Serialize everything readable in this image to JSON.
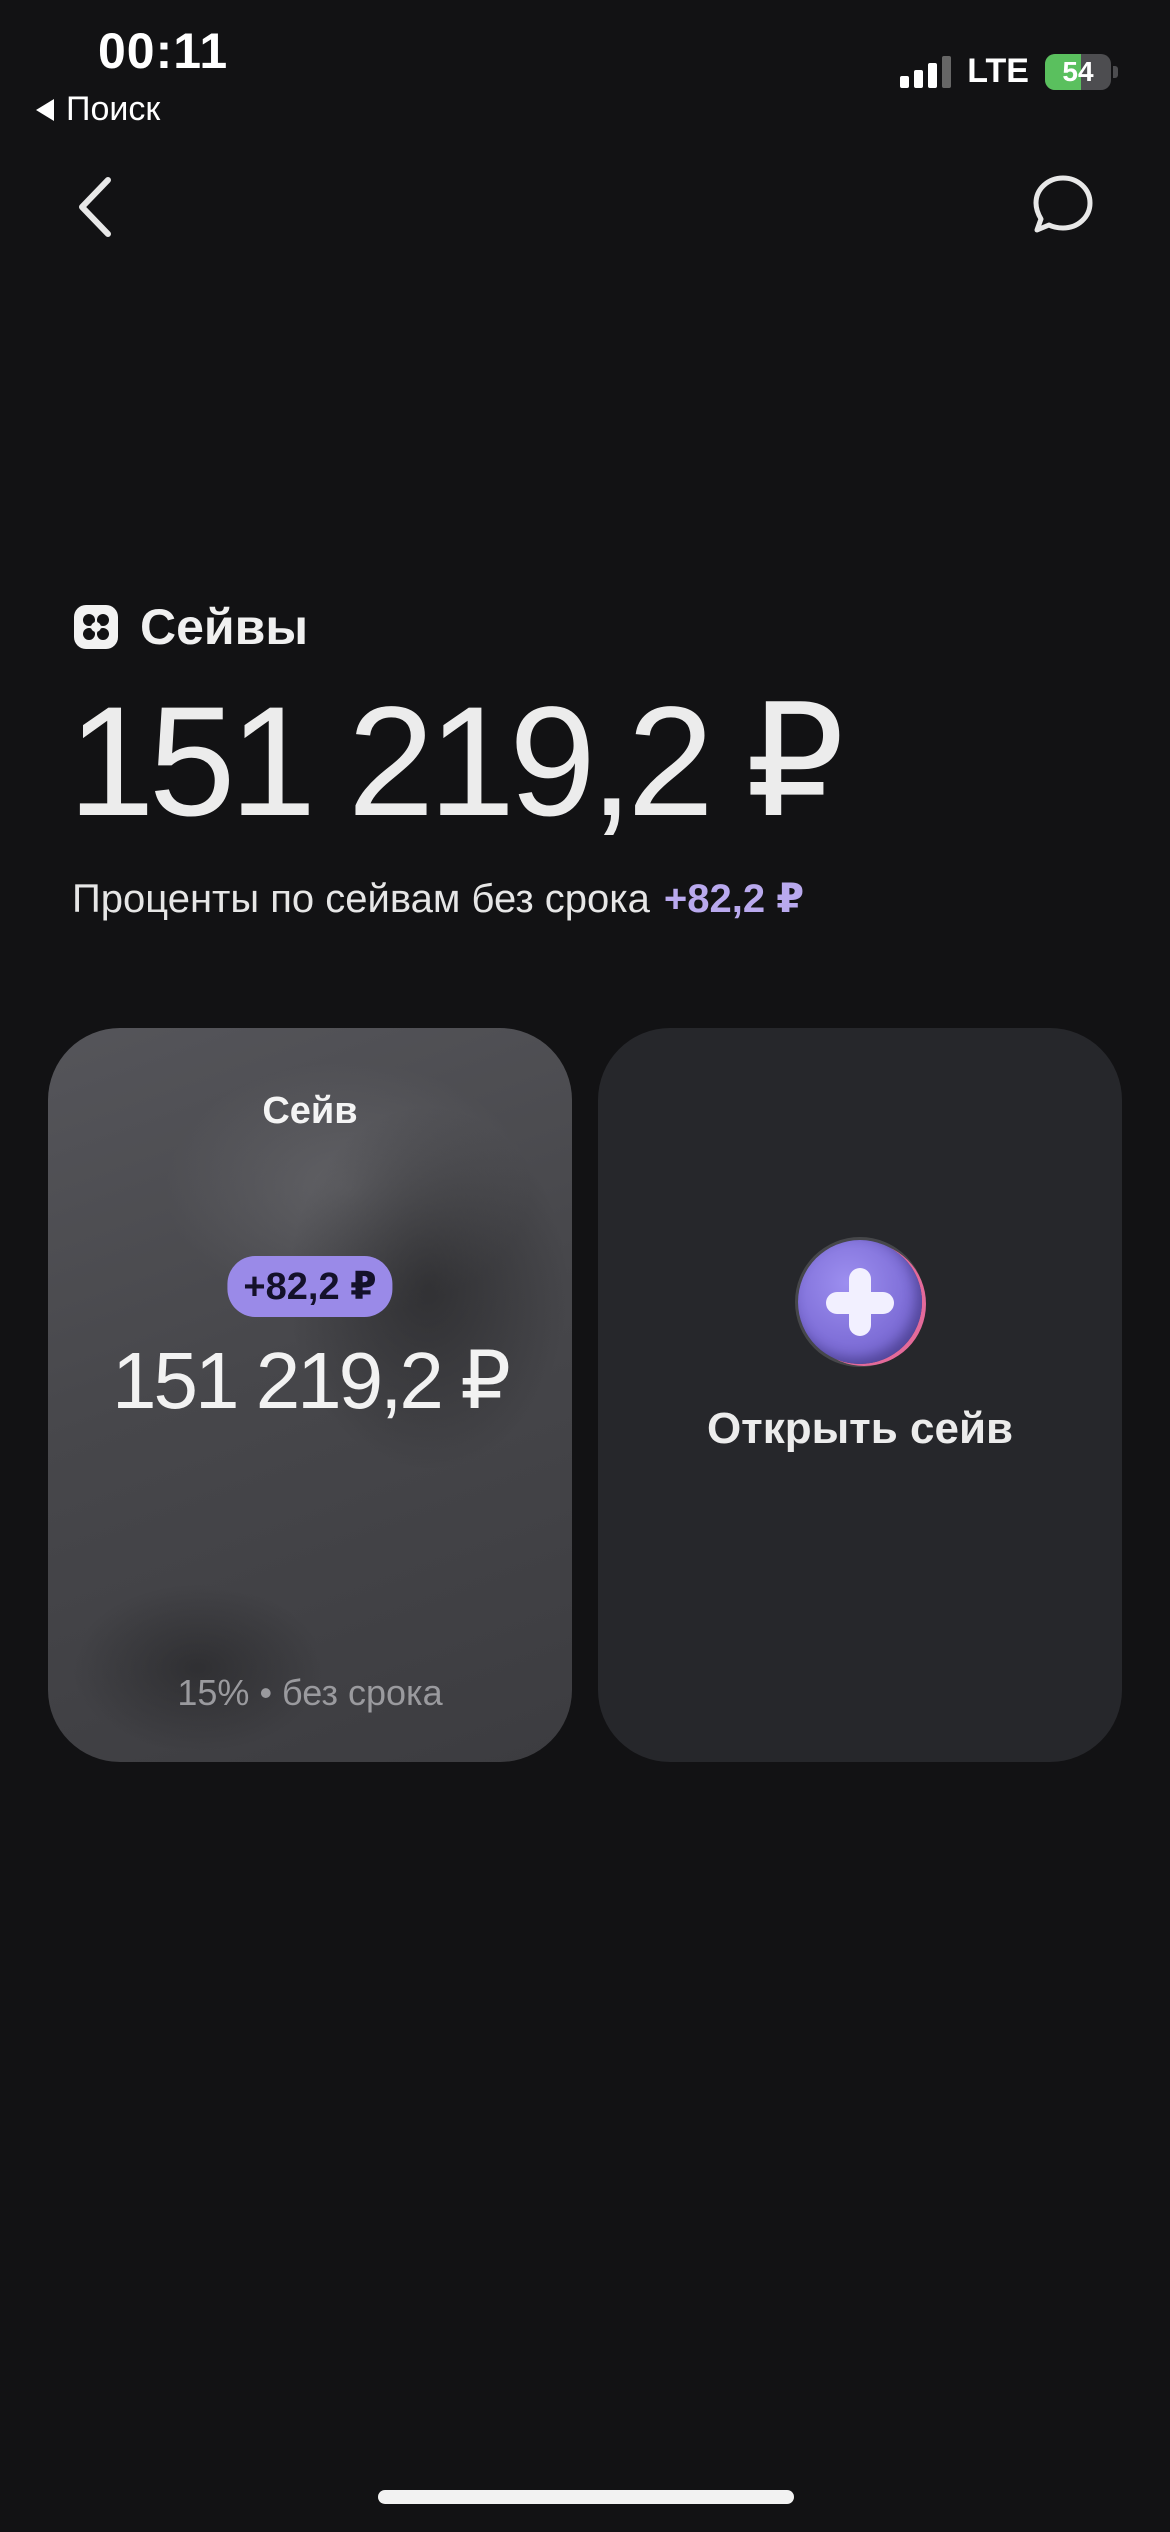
{
  "status_bar": {
    "time": "00:11",
    "back_app_label": "Поиск",
    "network": "LTE",
    "battery_percent": 54,
    "battery_label": "54"
  },
  "nav": {
    "back_icon": "chevron-left-icon",
    "chat_icon": "chat-bubble-icon"
  },
  "header": {
    "title": "Сейвы",
    "total": "151 219,2 ₽",
    "interest_label": "Проценты по сейвам без срока",
    "interest_value": "+82,2 ₽"
  },
  "cards": {
    "save": {
      "title": "Сейв",
      "badge": "+82,2 ₽",
      "amount": "151 219,2 ₽",
      "rate": "15% • без срока"
    },
    "open": {
      "label": "Открыть сейв",
      "icon": "plus-icon"
    }
  },
  "colors": {
    "background": "#121214",
    "accent": "#9a8ae8",
    "card_dark": "#26272b"
  }
}
